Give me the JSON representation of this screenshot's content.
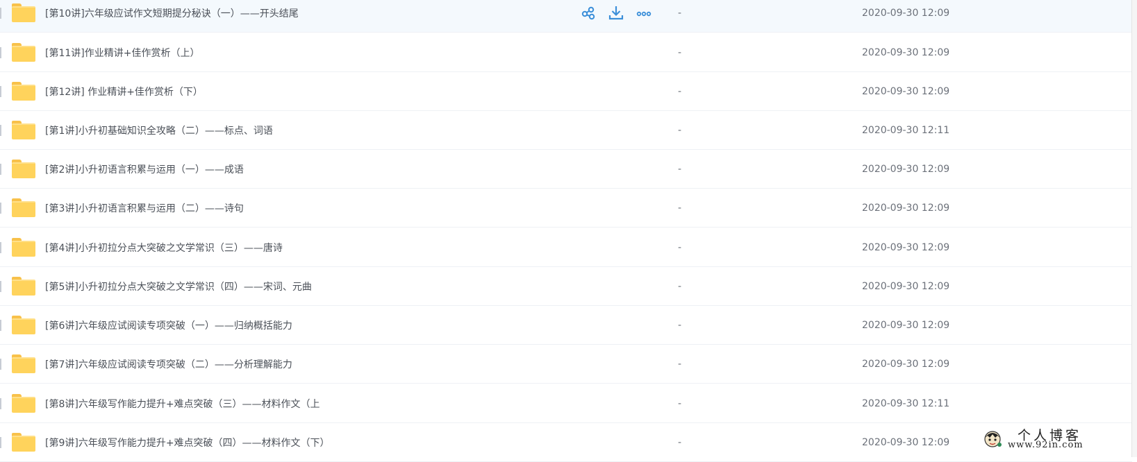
{
  "file_list": {
    "rows": [
      {
        "name": "[第10讲]六年级应试作文短期提分秘诀（一）——开头结尾",
        "size": "-",
        "modified": "2020-09-30 12:09"
      },
      {
        "name": "[第11讲]作业精讲+佳作赏析（上）",
        "size": "-",
        "modified": "2020-09-30 12:09"
      },
      {
        "name": "[第12讲] 作业精讲+佳作赏析（下）",
        "size": "-",
        "modified": "2020-09-30 12:09"
      },
      {
        "name": "[第1讲]小升初基础知识全攻略（二）——标点、词语",
        "size": "-",
        "modified": "2020-09-30 12:11"
      },
      {
        "name": "[第2讲]小升初语言积累与运用（一）——成语",
        "size": "-",
        "modified": "2020-09-30 12:09"
      },
      {
        "name": "[第3讲]小升初语言积累与运用（二）——诗句",
        "size": "-",
        "modified": "2020-09-30 12:09"
      },
      {
        "name": "[第4讲]小升初拉分点大突破之文学常识（三）——唐诗",
        "size": "-",
        "modified": "2020-09-30 12:09"
      },
      {
        "name": "[第5讲]小升初拉分点大突破之文学常识（四）——宋词、元曲",
        "size": "-",
        "modified": "2020-09-30 12:09"
      },
      {
        "name": "[第6讲]六年级应试阅读专项突破（一）——归纳概括能力",
        "size": "-",
        "modified": "2020-09-30 12:09"
      },
      {
        "name": "[第7讲]六年级应试阅读专项突破（二）——分析理解能力",
        "size": "-",
        "modified": "2020-09-30 12:09"
      },
      {
        "name": "[第8讲]六年级写作能力提升+难点突破（三）——材料作文（上",
        "size": "-",
        "modified": "2020-09-30 12:11"
      },
      {
        "name": "[第9讲]六年级写作能力提升+难点突破（四）——材料作文（下）",
        "size": "-",
        "modified": "2020-09-30 12:09"
      }
    ],
    "hover_actions": [
      "share-icon",
      "download-icon",
      "more-icon"
    ]
  },
  "watermark": {
    "title": "个人博客",
    "url": "www.92in.com"
  },
  "colors": {
    "accent": "#3b8fd9",
    "folder": "#ffd35c",
    "text": "#4a4f57",
    "selected_row": "#f4f9fd"
  }
}
